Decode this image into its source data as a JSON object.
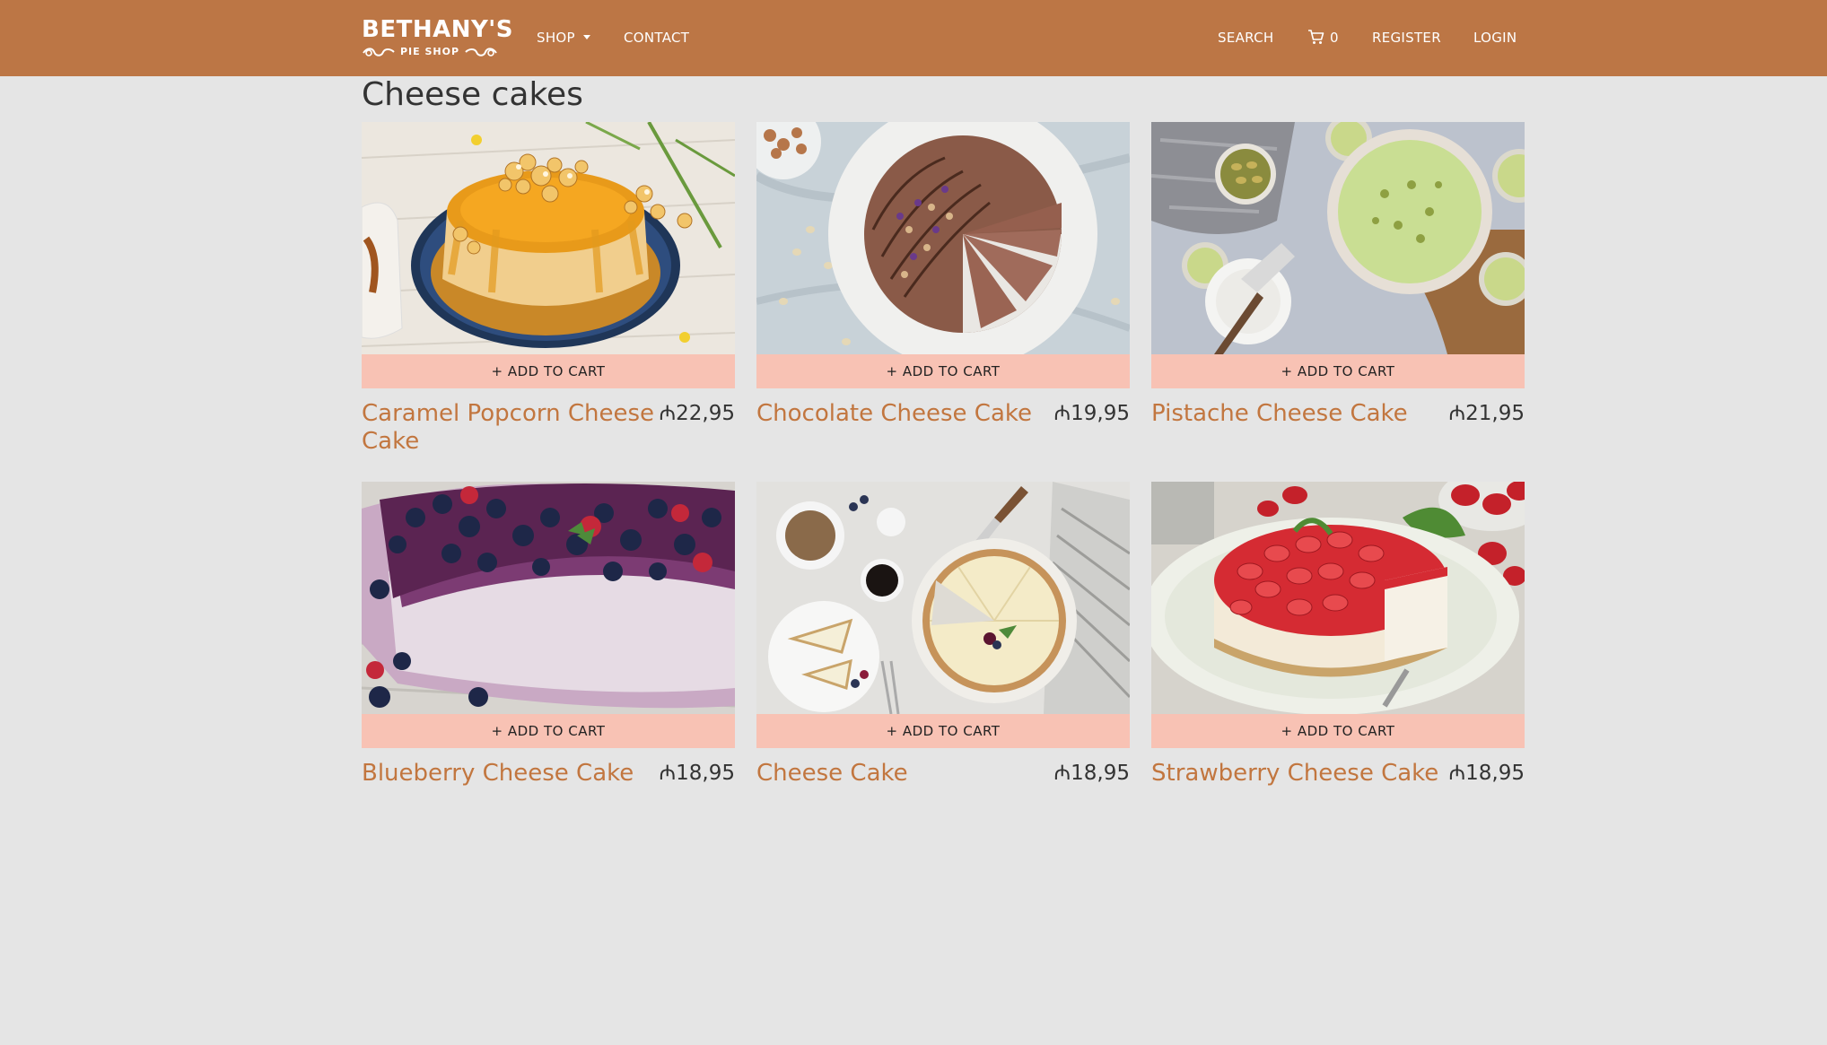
{
  "header": {
    "logo_main": "BETHANY'S",
    "logo_sub": "PIE SHOP",
    "nav": {
      "shop": "SHOP",
      "contact": "CONTACT",
      "search": "SEARCH",
      "cart_count": "0",
      "register": "REGISTER",
      "login": "LOGIN"
    },
    "background_color": "#bc7645"
  },
  "main": {
    "title": "Cheese cakes",
    "add_to_cart_label": "+ ADD TO CART",
    "products": [
      {
        "name": "Caramel Popcorn Cheese Cake",
        "price": "₼22,95"
      },
      {
        "name": "Chocolate Cheese Cake",
        "price": "₼19,95"
      },
      {
        "name": "Pistache Cheese Cake",
        "price": "₼21,95"
      },
      {
        "name": "Blueberry Cheese Cake",
        "price": "₼18,95"
      },
      {
        "name": "Cheese Cake",
        "price": "₼18,95"
      },
      {
        "name": "Strawberry Cheese Cake",
        "price": "₼18,95"
      }
    ]
  },
  "colors": {
    "accent": "#c2763f",
    "button": "#f8c2b4",
    "page_background": "#e5e5e5"
  }
}
